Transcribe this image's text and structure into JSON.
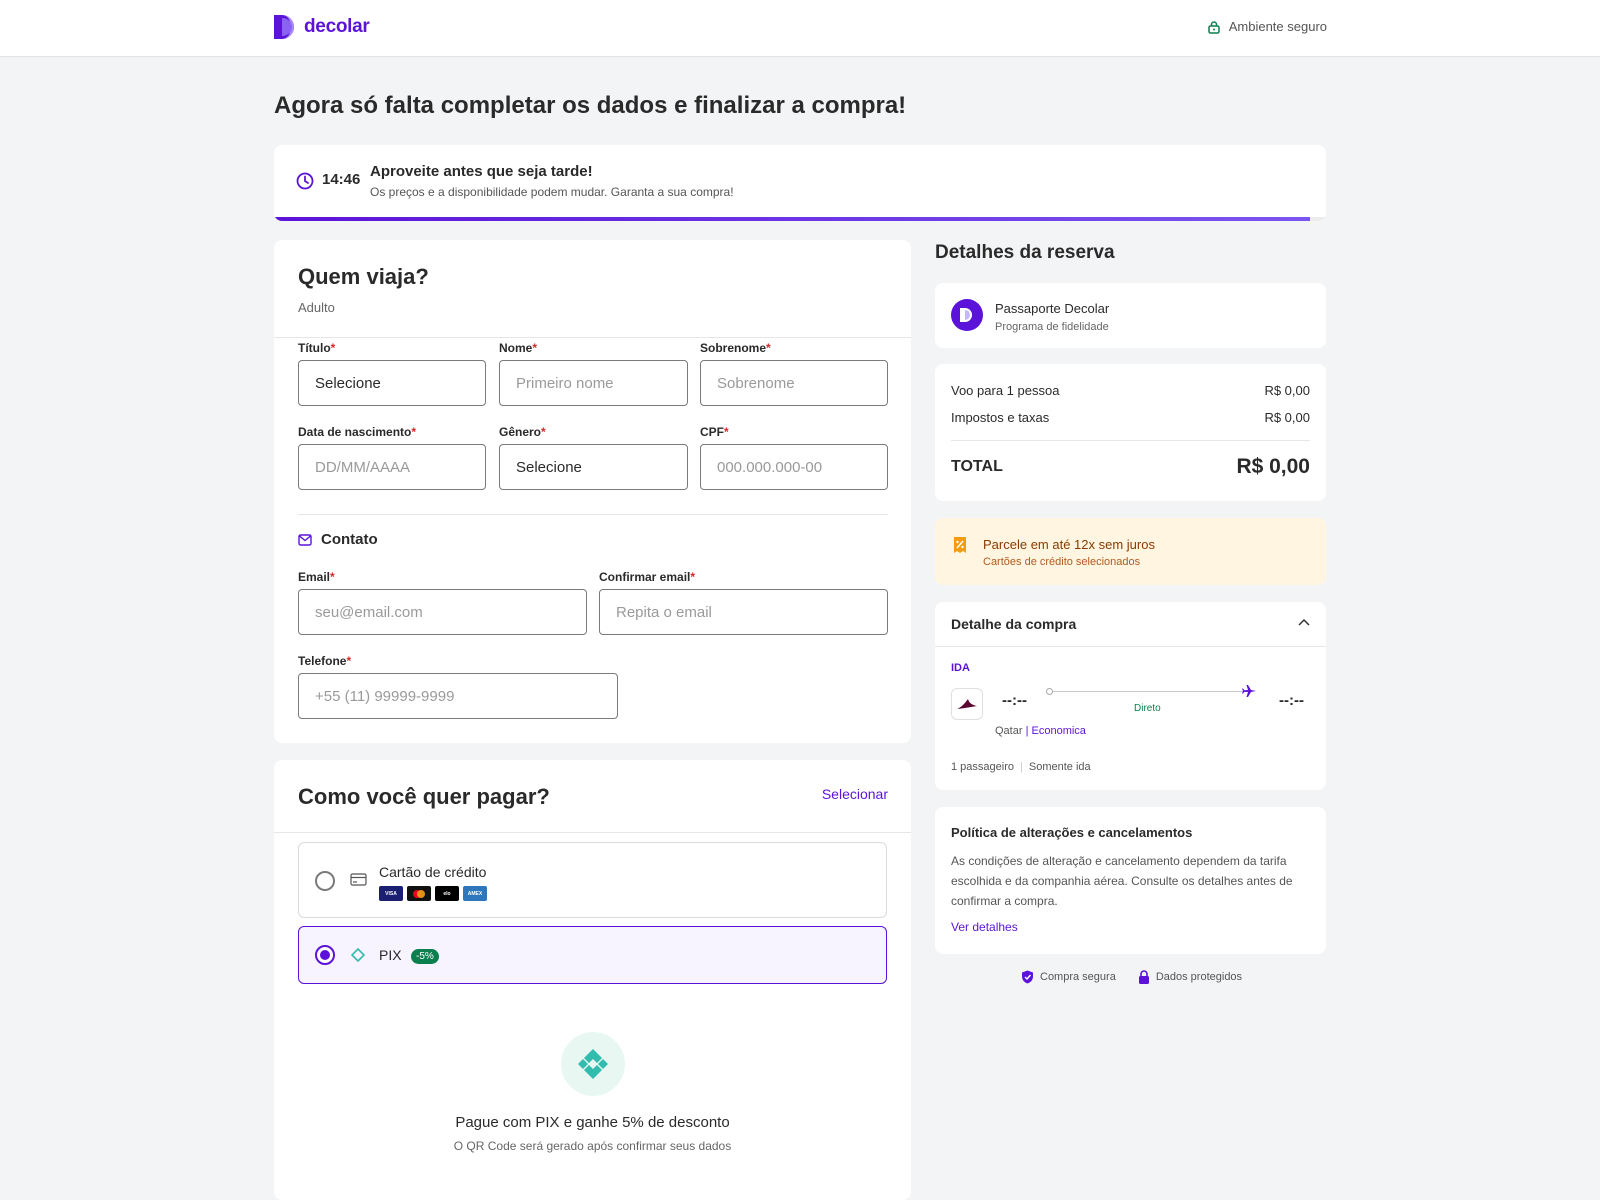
{
  "header": {
    "logo_text": "decolar",
    "secure_label": "Ambiente seguro"
  },
  "page_title": "Agora só falta completar os dados e finalizar a compra!",
  "timer": {
    "time": "14:46",
    "title": "Aproveite antes que seja tarde!",
    "subtitle": "Os preços e a disponibilidade podem mudar. Garanta a sua compra!",
    "progress": 0.985
  },
  "traveler": {
    "title": "Quem viaja?",
    "subtitle": "Adulto",
    "fields": {
      "titulo": {
        "label": "Título",
        "value": "Selecione"
      },
      "nome": {
        "label": "Nome",
        "placeholder": "Primeiro nome"
      },
      "sobrenome": {
        "label": "Sobrenome",
        "placeholder": "Sobrenome"
      },
      "nascimento": {
        "label": "Data de nascimento",
        "placeholder": "DD/MM/AAAA"
      },
      "genero": {
        "label": "Gênero",
        "value": "Selecione"
      },
      "cpf": {
        "label": "CPF",
        "placeholder": "000.000.000-00"
      }
    },
    "required_mark": "*",
    "contact": {
      "title": "Contato",
      "email": {
        "label": "Email",
        "placeholder": "seu@email.com"
      },
      "confirm_email": {
        "label": "Confirmar email",
        "placeholder": "Repita o email"
      },
      "phone": {
        "label": "Telefone",
        "placeholder": "+55 (11) 99999-9999"
      }
    }
  },
  "payment": {
    "title": "Como você quer pagar?",
    "select_link": "Selecionar",
    "options": [
      {
        "label": "Cartão de crédito",
        "brands": [
          "VISA",
          "MC",
          "elo",
          "AMEX"
        ],
        "selected": false
      },
      {
        "label": "PIX",
        "badge": "-5%",
        "selected": true
      }
    ],
    "pix_title": "Pague com PIX e ganhe 5% de desconto",
    "pix_subtitle": "O QR Code será gerado após confirmar seus dados"
  },
  "sidebar": {
    "title": "Detalhes da reserva",
    "passport": {
      "title": "Passaporte Decolar",
      "subtitle": "Programa de fidelidade"
    },
    "prices": {
      "rows": [
        {
          "label": "Voo para 1 pessoa",
          "value": "R$ 0,00"
        },
        {
          "label": "Impostos e taxas",
          "value": "R$ 0,00"
        }
      ],
      "total_label": "TOTAL",
      "total_value": "R$ 0,00"
    },
    "installments": {
      "title": "Parcele em até 12x sem juros",
      "subtitle": "Cartões de crédito selecionados"
    },
    "purchase_detail": {
      "title": "Detalhe da compra",
      "direction": "IDA",
      "departure_time": "--:--",
      "arrival_time": "--:--",
      "stops": "Direto",
      "airline": "Qatar",
      "cabin_separator": "|",
      "cabin": "Economica",
      "passengers": "1 passageiro",
      "trip_type": "Somente ida",
      "meta_separator": "|"
    },
    "policy": {
      "title": "Política de alterações e cancelamentos",
      "text": "As condições de alteração e cancelamento dependem da tarifa escolhida e da companhia aérea. Consulte os detalhes antes de confirmar a compra.",
      "link": "Ver detalhes"
    },
    "trust": {
      "secure_purchase": "Compra segura",
      "protected_data": "Dados protegidos"
    }
  },
  "colors": {
    "brand": "#5b13d9",
    "success": "#0c7f4e",
    "installment_bg": "#fff5e0"
  }
}
